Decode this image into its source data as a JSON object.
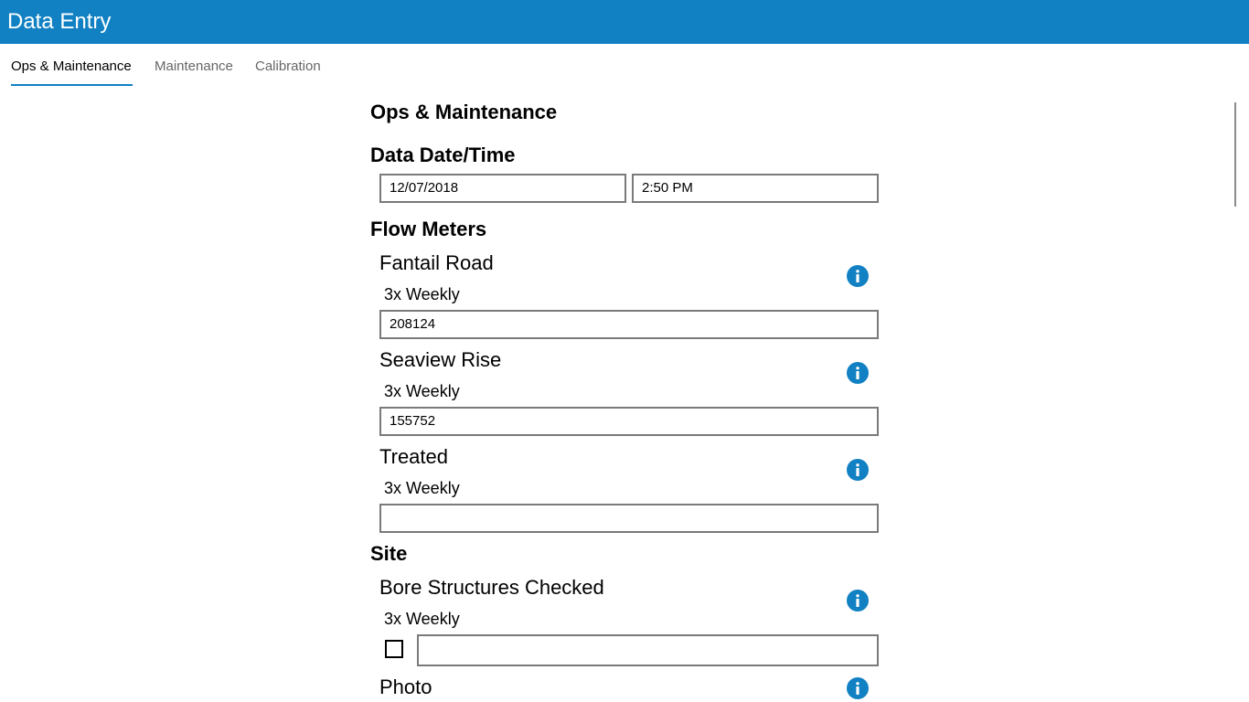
{
  "app": {
    "title": "Data Entry",
    "accent": "#1181c3"
  },
  "tabs": [
    {
      "label": "Ops & Maintenance",
      "active": true
    },
    {
      "label": "Maintenance",
      "active": false
    },
    {
      "label": "Calibration",
      "active": false
    }
  ],
  "page": {
    "heading": "Ops & Maintenance",
    "datetime": {
      "heading": "Data Date/Time",
      "date": "12/07/2018",
      "time": "2:50 PM"
    },
    "flow_meters": {
      "heading": "Flow Meters",
      "items": [
        {
          "label": "Fantail Road",
          "frequency": "3x Weekly",
          "value": "208124",
          "icon": "info-icon"
        },
        {
          "label": "Seaview Rise",
          "frequency": "3x Weekly",
          "value": "155752",
          "icon": "info-icon"
        },
        {
          "label": "Treated",
          "frequency": "3x Weekly",
          "value": "",
          "icon": "info-icon"
        }
      ]
    },
    "site": {
      "heading": "Site",
      "items": [
        {
          "label": "Bore Structures Checked",
          "frequency": "3x Weekly",
          "checked": false,
          "comment": "",
          "icon": "info-icon"
        },
        {
          "label": "Photo",
          "icon": "info-icon"
        }
      ]
    }
  }
}
